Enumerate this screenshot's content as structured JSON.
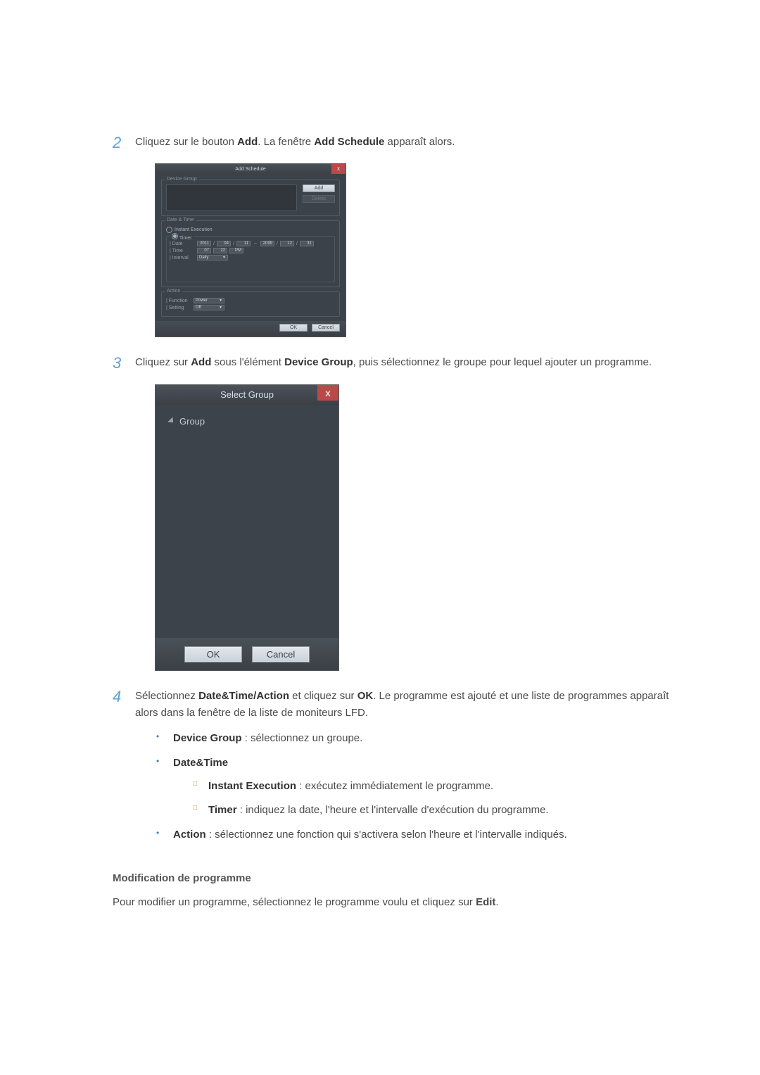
{
  "steps": {
    "s2": {
      "num": "2",
      "pre": "Cliquez sur le bouton ",
      "b1": "Add",
      "mid": ". La fenêtre ",
      "b2": "Add Schedule",
      "post": " apparaît alors."
    },
    "s3": {
      "num": "3",
      "pre": "Cliquez sur ",
      "b1": "Add",
      "mid": " sous l'élément ",
      "b2": "Device Group",
      "post": ", puis sélectionnez le groupe pour lequel ajouter un programme."
    },
    "s4": {
      "num": "4",
      "pre": "Sélectionnez ",
      "b1": "Date&Time/Action",
      "mid": " et cliquez sur ",
      "b2": "OK",
      "post": ". Le programme est ajouté et une liste de programmes apparaît alors dans la fenêtre de la liste de moniteurs LFD."
    }
  },
  "addScheduleDialog": {
    "title": "Add Schedule",
    "close": "x",
    "deviceGroup": {
      "label": "Device Group",
      "add": "Add",
      "delete": "Delete"
    },
    "dateTime": {
      "label": "Date & Time",
      "instant": "Instant Execution",
      "timer": "Timer",
      "dateLabel": "| Date",
      "date": {
        "y1": "2011",
        "m1": "04",
        "d1": "11",
        "y2": "2099",
        "m2": "12",
        "d2": "31"
      },
      "sep": "/",
      "tilde": "~",
      "timeLabel": "| Time",
      "time": {
        "hh": "07",
        "mm": "22",
        "ampm": "PM"
      },
      "intervalLabel": "| Interval",
      "interval": "Daily"
    },
    "action": {
      "label": "Action",
      "functionLabel": "| Function",
      "function": "Power",
      "settingLabel": "| Setting",
      "setting": "Off"
    },
    "footer": {
      "ok": "OK",
      "cancel": "Cancel"
    }
  },
  "selectGroupDialog": {
    "title": "Select Group",
    "close": "x",
    "root": "Group",
    "ok": "OK",
    "cancel": "Cancel"
  },
  "bullets": {
    "deviceGroup": {
      "term": "Device Group",
      "desc": " : sélectionnez un groupe."
    },
    "dateTime": {
      "term": "Date&Time"
    },
    "instant": {
      "term": "Instant Execution",
      "desc": " : exécutez immédiatement le programme."
    },
    "timer": {
      "term": "Timer",
      "desc": " : indiquez la date, l'heure et l'intervalle d'exécution du programme."
    },
    "action": {
      "term": "Action",
      "desc": " : sélectionnez une fonction qui s'activera selon l'heure et l'intervalle indiqués."
    }
  },
  "modHeading": "Modification de programme",
  "modBody": {
    "pre": "Pour modifier un programme, sélectionnez le programme voulu et cliquez sur ",
    "b": "Edit",
    "post": "."
  }
}
